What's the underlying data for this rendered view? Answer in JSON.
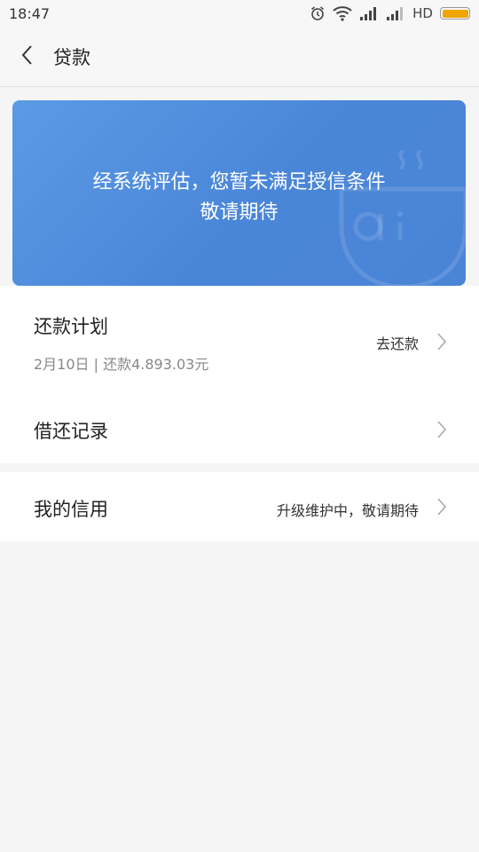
{
  "status_bar": {
    "time": "18:47",
    "network": "HD",
    "icons": [
      "alarm-icon",
      "wifi-icon",
      "signal-icon",
      "signal-icon",
      "battery-icon"
    ]
  },
  "header": {
    "back_icon": "chevron-left-icon",
    "title": "贷款"
  },
  "banner": {
    "line1": "经系统评估，您暂未满足授信条件",
    "line2": "敬请期待",
    "color": "#4f8ddd"
  },
  "repayment_plan": {
    "title": "还款计划",
    "subtitle": "2月10日 | 还款4.893.03元",
    "action": "去还款"
  },
  "records": {
    "title": "借还记录"
  },
  "credit": {
    "title": "我的信用",
    "status": "升级维护中，敬请期待"
  },
  "colors": {
    "background": "#f5f5f5",
    "card": "#ffffff",
    "battery": "#f0a500"
  }
}
